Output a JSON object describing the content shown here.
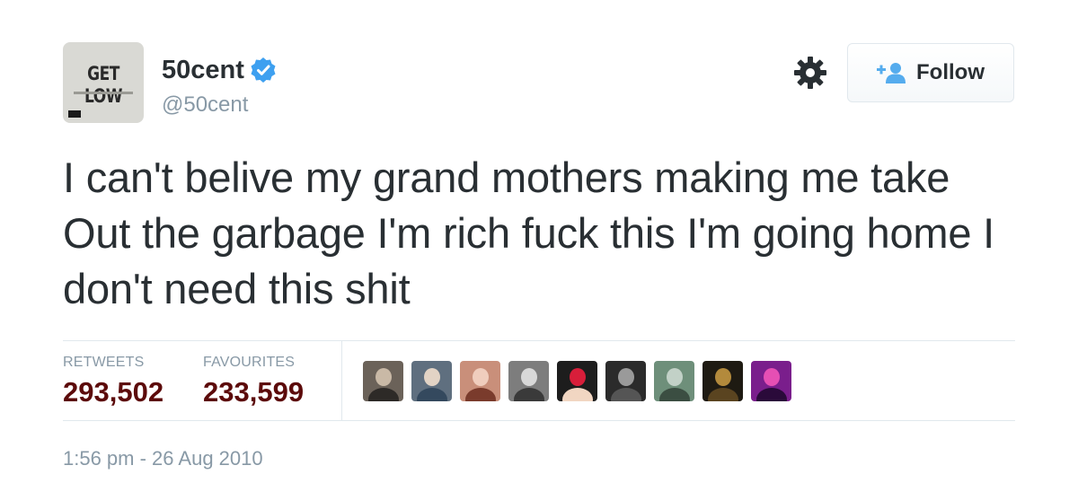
{
  "user": {
    "display_name": "50cent",
    "handle": "@50cent",
    "avatar_text": "GET LOW",
    "verified": true
  },
  "actions": {
    "follow_label": "Follow",
    "settings_icon": "gear-icon",
    "follow_icon": "add-user-icon"
  },
  "tweet": {
    "text": "I can't belive my grand mothers making me take Out the garbage I'm rich fuck this I'm going home I don't need this shit",
    "timestamp": "1:56 pm - 26 Aug 2010"
  },
  "stats": {
    "retweets_label": "RETWEETS",
    "retweets_value": "293,502",
    "favourites_label": "FAVOURITES",
    "favourites_value": "233,599"
  },
  "favouriters": [
    {
      "name": "favouriter-1",
      "colors": [
        "#6b6259",
        "#c9b9a6",
        "#2d2a27"
      ]
    },
    {
      "name": "favouriter-2",
      "colors": [
        "#5f6f7f",
        "#e2d3c5",
        "#34495e"
      ]
    },
    {
      "name": "favouriter-3",
      "colors": [
        "#c98f7a",
        "#f0cdbd",
        "#7a3b2c"
      ]
    },
    {
      "name": "favouriter-4",
      "colors": [
        "#7d7d7d",
        "#d8d8d8",
        "#3a3a3a"
      ]
    },
    {
      "name": "favouriter-5",
      "colors": [
        "#1d1d1d",
        "#d81e3a",
        "#f1d6c2"
      ]
    },
    {
      "name": "favouriter-6",
      "colors": [
        "#2b2b2b",
        "#9a9a9a",
        "#555555"
      ]
    },
    {
      "name": "favouriter-7",
      "colors": [
        "#6e8f7a",
        "#c2d1c7",
        "#3b4e42"
      ]
    },
    {
      "name": "favouriter-8",
      "colors": [
        "#1e1a12",
        "#b38a3c",
        "#5a4420"
      ]
    },
    {
      "name": "favouriter-9",
      "colors": [
        "#7a1e8c",
        "#e64fb4",
        "#2a0a3a"
      ]
    }
  ],
  "colors": {
    "verified_blue": "#3ea0f0",
    "stat_value": "#5c0a0a",
    "muted_text": "#8899a6",
    "follow_icon_blue": "#55acee"
  }
}
